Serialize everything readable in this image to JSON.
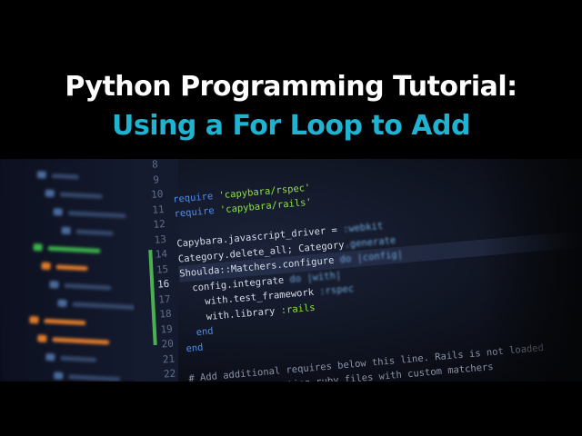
{
  "title": {
    "line1": "Python Programming Tutorial:",
    "line2": "Using a For Loop to Add"
  },
  "colors": {
    "line1": "#ffffff",
    "line2": "#1fb3d1",
    "keyword": "#4b8ff0",
    "string": "#8ee04a"
  },
  "editor": {
    "line_numbers": [
      "8",
      "9",
      "10",
      "11",
      "12",
      "13",
      "14",
      "15",
      "16",
      "17",
      "18",
      "19",
      "20",
      "21",
      "22"
    ],
    "current_line": "16",
    "code": [
      {
        "indent": "",
        "a": "",
        "kw": "",
        "b": ""
      },
      {
        "indent": "",
        "kw": "require ",
        "str": "'capybara/rspec'"
      },
      {
        "indent": "",
        "kw": "require ",
        "str": "'capybara/rails'"
      },
      {
        "indent": "",
        "text": ""
      },
      {
        "indent": "",
        "text": "Capybara.javascript_driver = ",
        "sym": ":webkit"
      },
      {
        "indent": "",
        "text": "Category.delete_all; Category",
        "sym": ".generate"
      },
      {
        "indent": "",
        "text": "Shoulda::Matchers.configure ",
        "sym": "do |config|"
      },
      {
        "indent": "  ",
        "text": "config.integrate ",
        "sym": "do |with|"
      },
      {
        "indent": "    ",
        "text": "with.test_framework ",
        "sym": ":rspec"
      },
      {
        "indent": "    ",
        "text": "with.library ",
        "str": ":rails"
      },
      {
        "indent": "  ",
        "kw": "end"
      },
      {
        "indent": "",
        "kw": "end"
      },
      {
        "indent": "",
        "text": ""
      },
      {
        "indent": "",
        "cm": "# Add additional requires below this line. Rails is not loaded"
      },
      {
        "indent": "",
        "cm": "# Requires supporting ruby files with custom matchers"
      }
    ]
  }
}
